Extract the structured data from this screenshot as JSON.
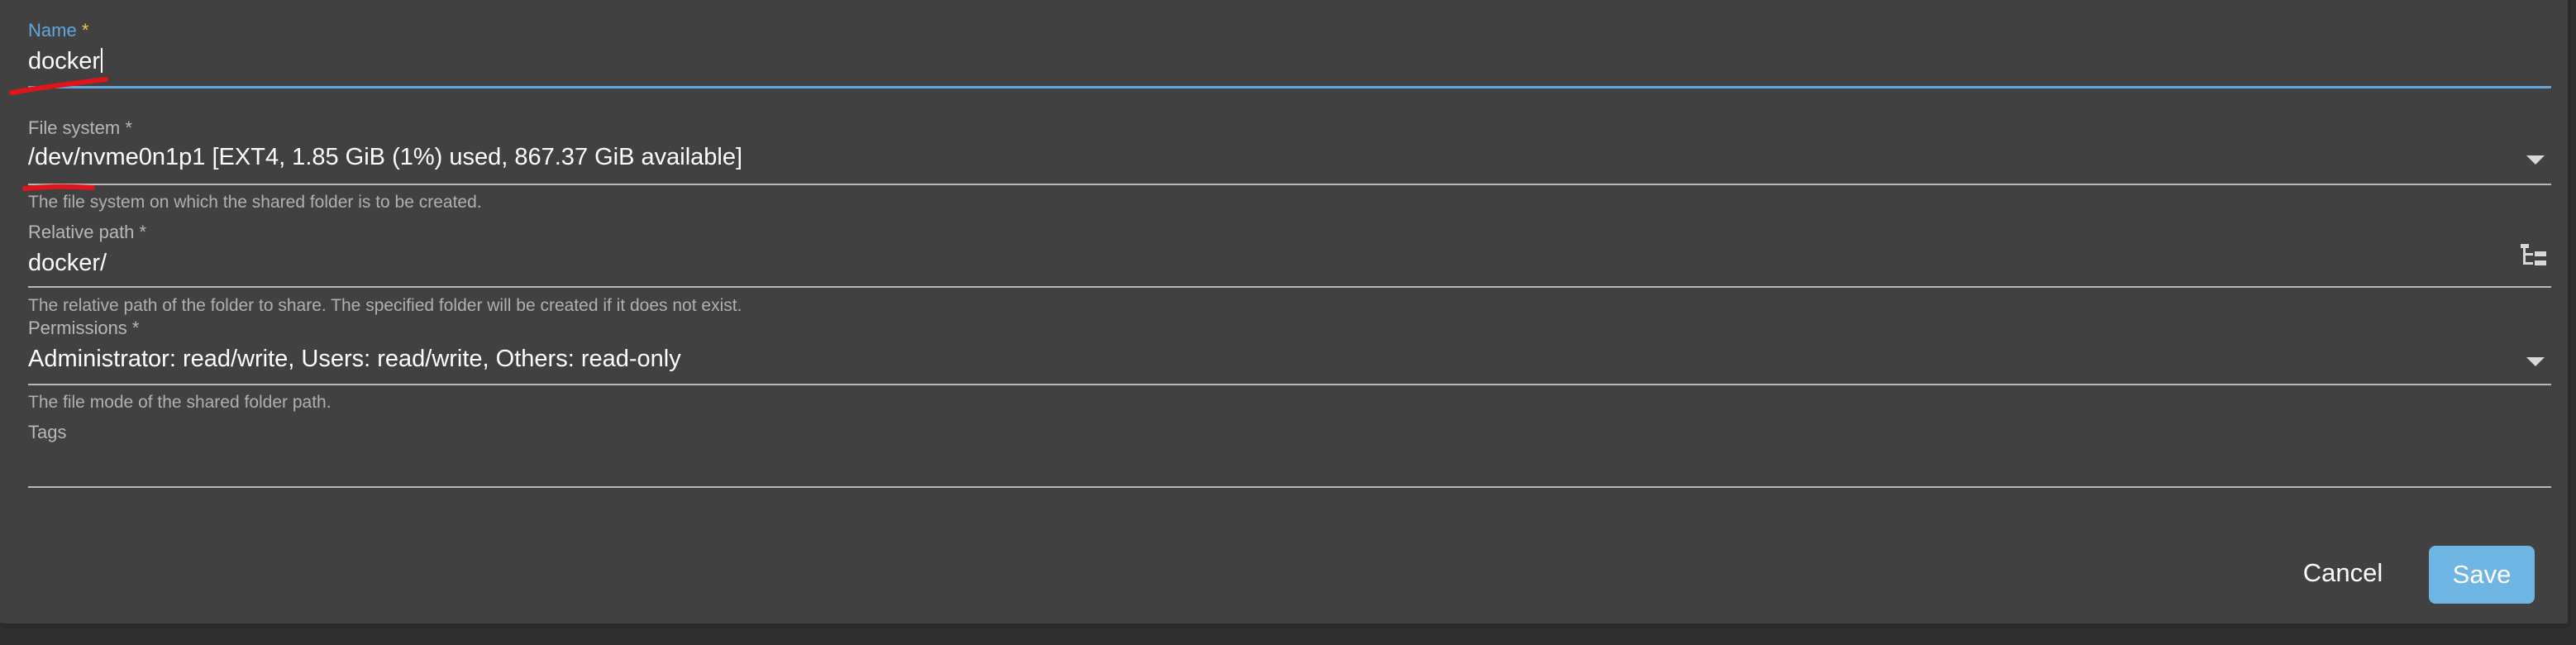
{
  "form": {
    "name": {
      "label": "Name",
      "required": "*",
      "value": "docker"
    },
    "filesystem": {
      "label": "File system *",
      "value": "/dev/nvme0n1p1 [EXT4, 1.85 GiB (1%) used, 867.37 GiB available]",
      "hint": "The file system on which the shared folder is to be created."
    },
    "relpath": {
      "label": "Relative path *",
      "value": "docker/",
      "hint": "The relative path of the folder to share. The specified folder will be created if it does not exist."
    },
    "permissions": {
      "label": "Permissions *",
      "value": "Administrator: read/write, Users: read/write, Others: read-only",
      "hint": "The file mode of the shared folder path."
    },
    "tags": {
      "label": "Tags",
      "value": ""
    }
  },
  "actions": {
    "cancel_label": "Cancel",
    "save_label": "Save"
  },
  "colors": {
    "accent": "#5fa7dd",
    "save_button": "#6fb5e4",
    "annotation": "#e0151c",
    "required_star": "#e8c84a"
  },
  "icons": {
    "filesystem_dropdown": "chevron-down-icon",
    "relpath_picker": "folder-tree-icon",
    "permissions_dropdown": "chevron-down-icon"
  }
}
